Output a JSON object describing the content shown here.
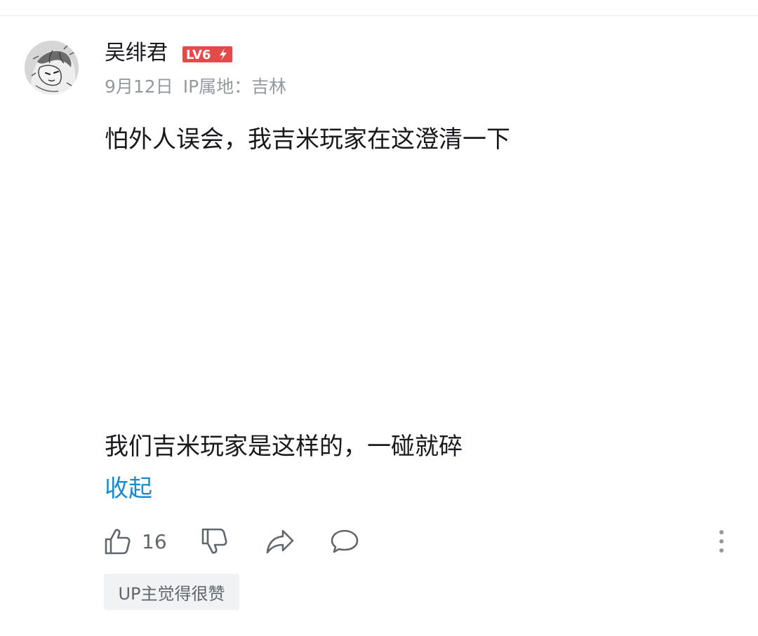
{
  "comment": {
    "author": {
      "name": "吴绯君",
      "level": "LV6",
      "avatar_icon": "sketch-avatar"
    },
    "date": "9月12日",
    "ip_location": "IP属地：吉林",
    "text_lines": [
      "怕外人误会，我吉米玩家在这澄清一下",
      "我们吉米玩家是这样的，一碰就碎"
    ],
    "collapse_label": "收起",
    "actions": {
      "like_icon": "thumbs-up-icon",
      "like_count": "16",
      "dislike_icon": "thumbs-down-icon",
      "share_icon": "share-icon",
      "reply_icon": "comment-bubble-icon",
      "more_icon": "more-vertical-icon"
    },
    "up_tag": "UP主觉得很赞"
  },
  "colors": {
    "text_primary": "#18191c",
    "text_secondary": "#9499a0",
    "link": "#178bcf",
    "level_badge": "#e34b4b",
    "tag_background": "#f1f2f3"
  }
}
